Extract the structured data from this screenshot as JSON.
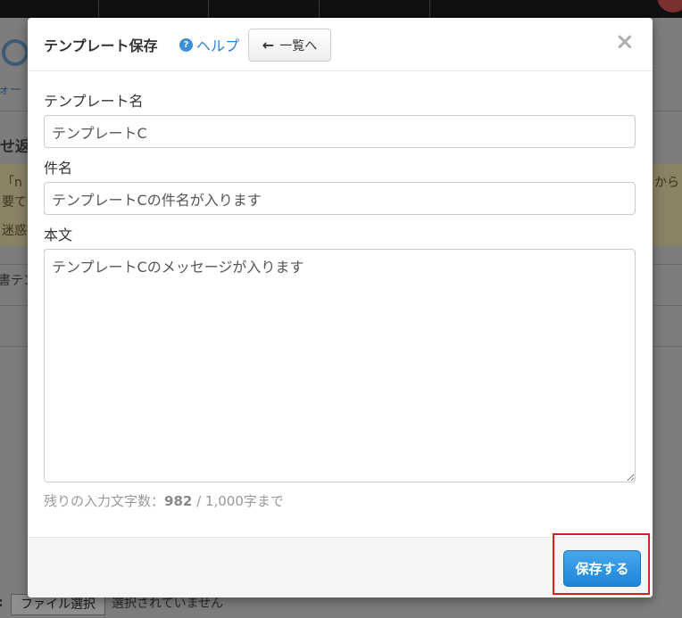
{
  "background": {
    "page_title_fragment": "せ返",
    "left_fragment": "ォー",
    "warn_fragment1": "「n",
    "warn_fragment2": "要て",
    "warn_fragment3": "迷惑",
    "right_fragment": "から",
    "row_fragment": "書テン",
    "file_button_label": "ファイル選択",
    "file_status": "選択されていません",
    "colon": ":"
  },
  "modal": {
    "title": "テンプレート保存",
    "help_label": "ヘルプ",
    "help_icon": "?",
    "back_button_label": "一覧へ",
    "close_icon": "×",
    "template_name_label": "テンプレート名",
    "template_name_value": "テンプレートC",
    "subject_label": "件名",
    "subject_value": "テンプレートCの件名が入ります",
    "body_label": "本文",
    "body_value": "テンプレートCのメッセージが入ります",
    "counter_prefix": "残りの入力文字数：",
    "counter_remaining": "982",
    "counter_suffix": " / 1,000字まで",
    "save_button_label": "保存する"
  },
  "colors": {
    "primary_button": "#2a8de0",
    "help_link": "#2a7fd0",
    "highlight": "#d42020"
  }
}
